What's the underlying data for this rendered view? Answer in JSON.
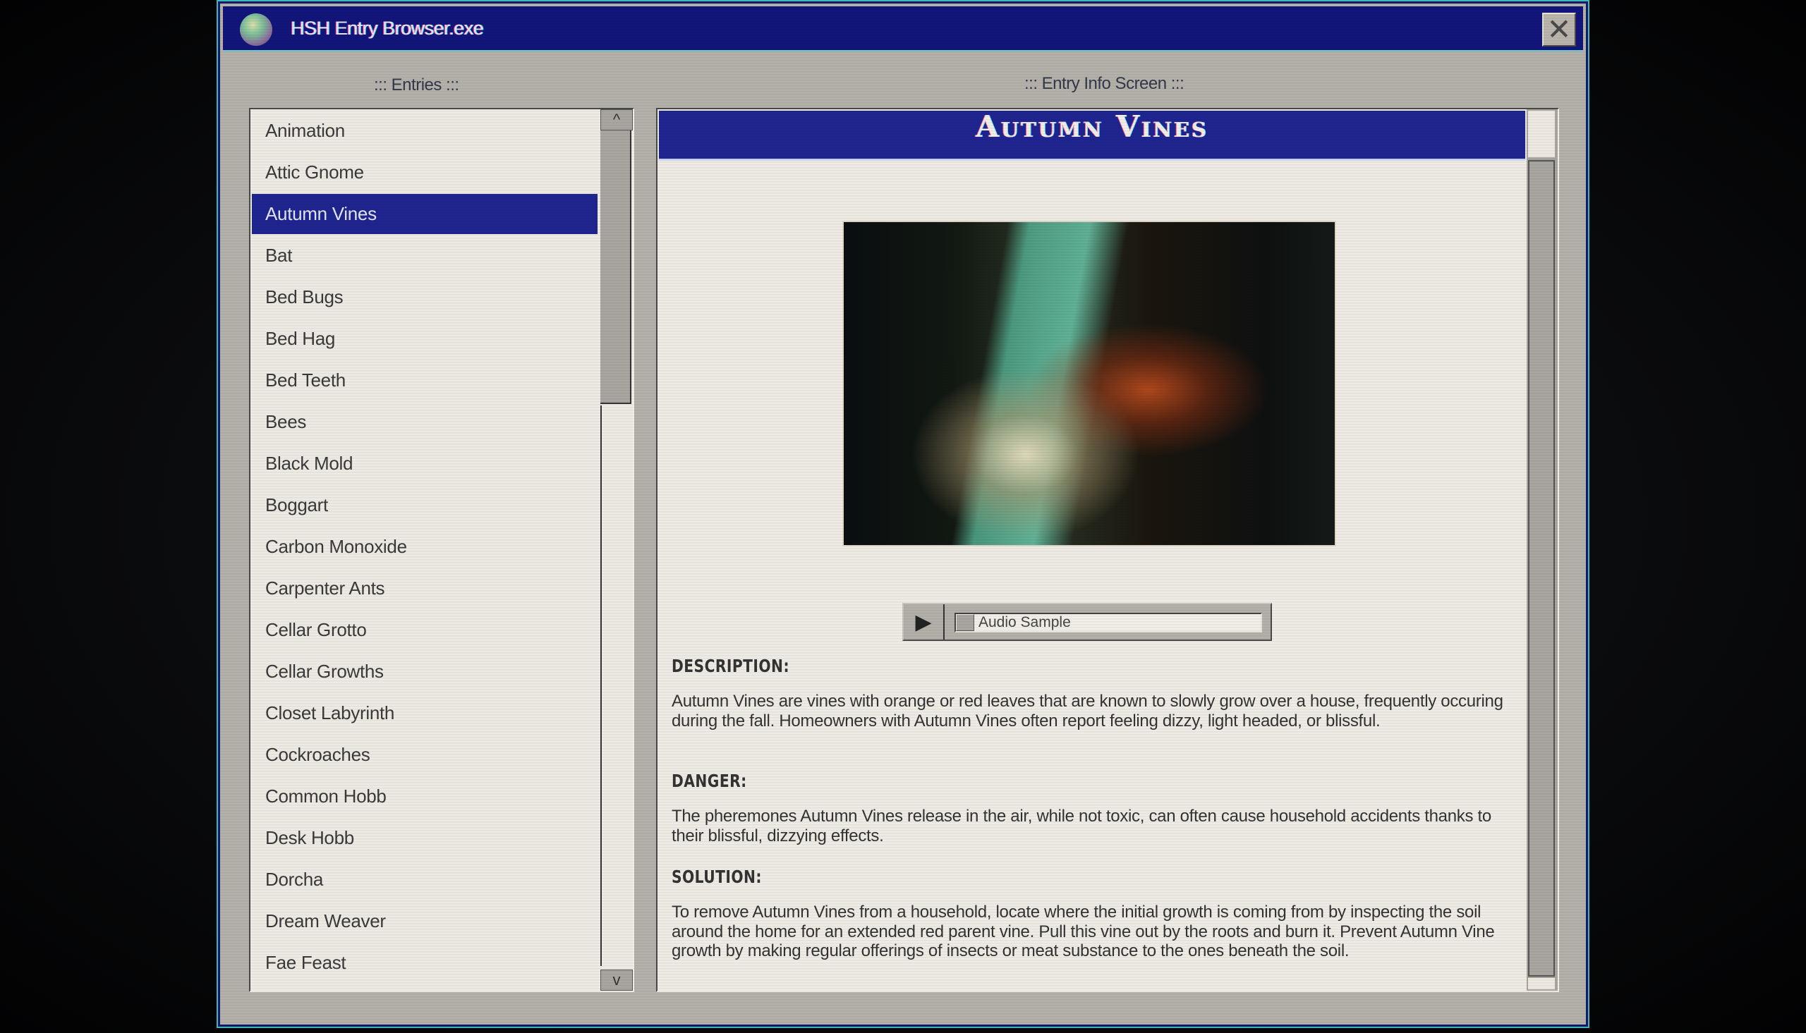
{
  "window": {
    "title": "HSH Entry Browser.exe",
    "icon": "globe-brain-icon",
    "close_label": "✕"
  },
  "entries_panel": {
    "label": "::: Entries :::",
    "scroll_up": "^",
    "scroll_down": "v",
    "selected": "Autumn Vines",
    "items": [
      {
        "label": "Animation"
      },
      {
        "label": "Attic Gnome"
      },
      {
        "label": "Autumn Vines"
      },
      {
        "label": "Bat"
      },
      {
        "label": "Bed Bugs"
      },
      {
        "label": "Bed Hag"
      },
      {
        "label": "Bed Teeth"
      },
      {
        "label": "Bees"
      },
      {
        "label": "Black Mold"
      },
      {
        "label": "Boggart"
      },
      {
        "label": "Carbon Monoxide"
      },
      {
        "label": "Carpenter Ants"
      },
      {
        "label": "Cellar Grotto"
      },
      {
        "label": "Cellar Growths"
      },
      {
        "label": "Closet Labyrinth"
      },
      {
        "label": "Cockroaches"
      },
      {
        "label": "Common Hobb"
      },
      {
        "label": "Desk Hobb"
      },
      {
        "label": "Dorcha"
      },
      {
        "label": "Dream Weaver"
      },
      {
        "label": "Fae Feast"
      }
    ]
  },
  "info_panel": {
    "label": "::: Entry Info Screen :::",
    "title": "Autumn Vines",
    "image_alt": "Photo of an old house corner with windows overgrown by red autumn vines",
    "audio": {
      "play_icon": "▶",
      "label": "Audio Sample",
      "progress": 0
    },
    "sections": [
      {
        "heading": "DESCRIPTION:",
        "body": "Autumn Vines are vines with orange or red leaves that are known to slowly grow over a house, frequently occuring during the fall. Homeowners with Autumn Vines often report feeling dizzy, light headed, or blissful."
      },
      {
        "heading": "DANGER:",
        "body": "The pheremones Autumn Vines release in the air, while not toxic, can often cause household accidents thanks to their blissful, dizzying effects."
      },
      {
        "heading": "SOLUTION:",
        "body": "To remove Autumn Vines from a household, locate where the initial growth is coming from by inspecting the soil around the home for an extended red parent vine. Pull this vine out by the roots and burn it. Prevent Autumn Vine growth by making regular offerings of insects or meat substance to the ones beneath the soil."
      }
    ]
  },
  "colors": {
    "title_bar": "#12157a",
    "selection": "#1f2590",
    "window_bg": "#b4b1ab",
    "panel_bg": "#eeebe4"
  }
}
